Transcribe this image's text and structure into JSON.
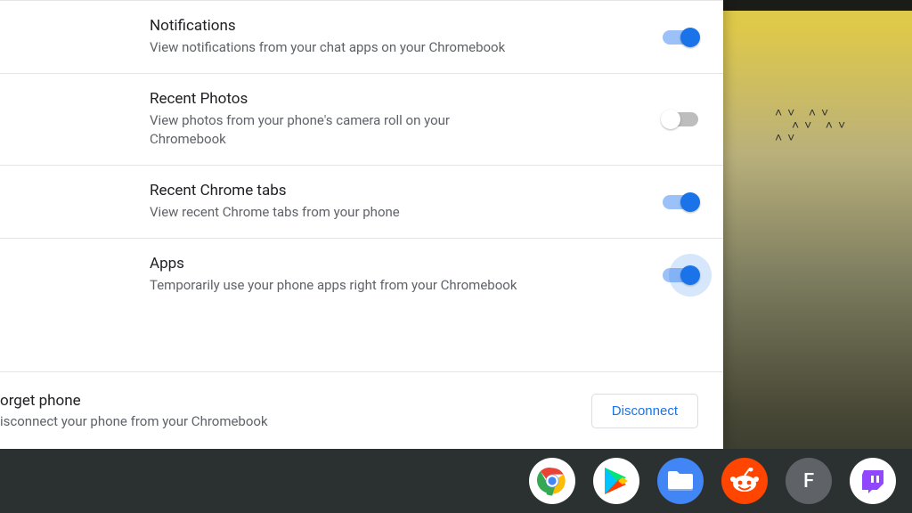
{
  "settings": [
    {
      "title": "Notifications",
      "desc": "View notifications from your chat apps on your Chromebook",
      "on": true,
      "focus": false
    },
    {
      "title": "Recent Photos",
      "desc": "View photos from your phone's camera roll on your Chromebook",
      "on": false,
      "focus": false
    },
    {
      "title": "Recent Chrome tabs",
      "desc": "View recent Chrome tabs from your phone",
      "on": true,
      "focus": false
    },
    {
      "title": "Apps",
      "desc": "Temporarily use your phone apps right from your Chromebook",
      "on": true,
      "focus": true
    }
  ],
  "forget": {
    "title": "orget phone",
    "desc": "isconnect your phone from your Chromebook",
    "button": "Disconnect"
  },
  "shelf": {
    "letter": "F"
  }
}
